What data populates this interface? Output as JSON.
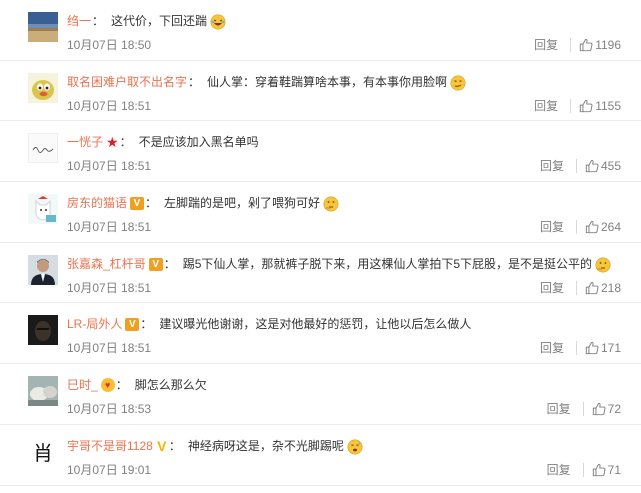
{
  "comments": [
    {
      "user": "绉一",
      "badge": "none",
      "text": "这代价，下回还踹",
      "emoji": "laugh-cry",
      "time": "10月07日 18:50",
      "reply": "回复",
      "likes": "1196",
      "avatar": "landscape"
    },
    {
      "user": "取名困难户取不出名字",
      "badge": "none",
      "text": "仙人掌：穿着鞋踹算啥本事，有本事你用脸啊",
      "emoji": "smirk",
      "time": "10月07日 18:51",
      "reply": "回复",
      "likes": "1155",
      "avatar": "cartoon-duck"
    },
    {
      "user": "一恍子",
      "badge": "star",
      "text": "不是应该加入黑名单吗",
      "emoji": "",
      "time": "10月07日 18:51",
      "reply": "回复",
      "likes": "455",
      "avatar": "signature"
    },
    {
      "user": "房东的猫语",
      "badge": "vip",
      "text": "左脚踹的是吧，剁了喂狗可好",
      "emoji": "thinking",
      "time": "10月07日 18:51",
      "reply": "回复",
      "likes": "264",
      "avatar": "cartoon-cat"
    },
    {
      "user": "张嘉森_杠杆哥",
      "badge": "vip",
      "text": "踢5下仙人掌，那就裤子脱下来，用这棵仙人掌拍下5下屁股，是不是挺公平的",
      "emoji": "thinking",
      "time": "10月07日 18:51",
      "reply": "回复",
      "likes": "218",
      "avatar": "man-suit"
    },
    {
      "user": "LR-局外人",
      "badge": "vip",
      "text": "建议曝光他谢谢，这是对他最好的惩罚，让他以后怎么做人",
      "emoji": "",
      "time": "10月07日 18:51",
      "reply": "回复",
      "likes": "171",
      "avatar": "dark-face"
    },
    {
      "user": "巳时_",
      "badge": "heart",
      "text": "脚怎么那么欠",
      "emoji": "",
      "time": "10月07日 18:53",
      "reply": "回复",
      "likes": "72",
      "avatar": "rocks"
    },
    {
      "user": "宇哥不是哥1128",
      "badge": "vyellow",
      "text": "神经病呀这是，杂不光脚踢呢",
      "emoji": "sweat",
      "time": "10月07日 19:01",
      "reply": "回复",
      "likes": "71",
      "avatar": "glyph"
    }
  ],
  "icons": {
    "like": "thumbs-up-icon"
  },
  "colors": {
    "username": "#eb7350",
    "text": "#333333",
    "meta": "#808080",
    "divider": "#ececec"
  }
}
